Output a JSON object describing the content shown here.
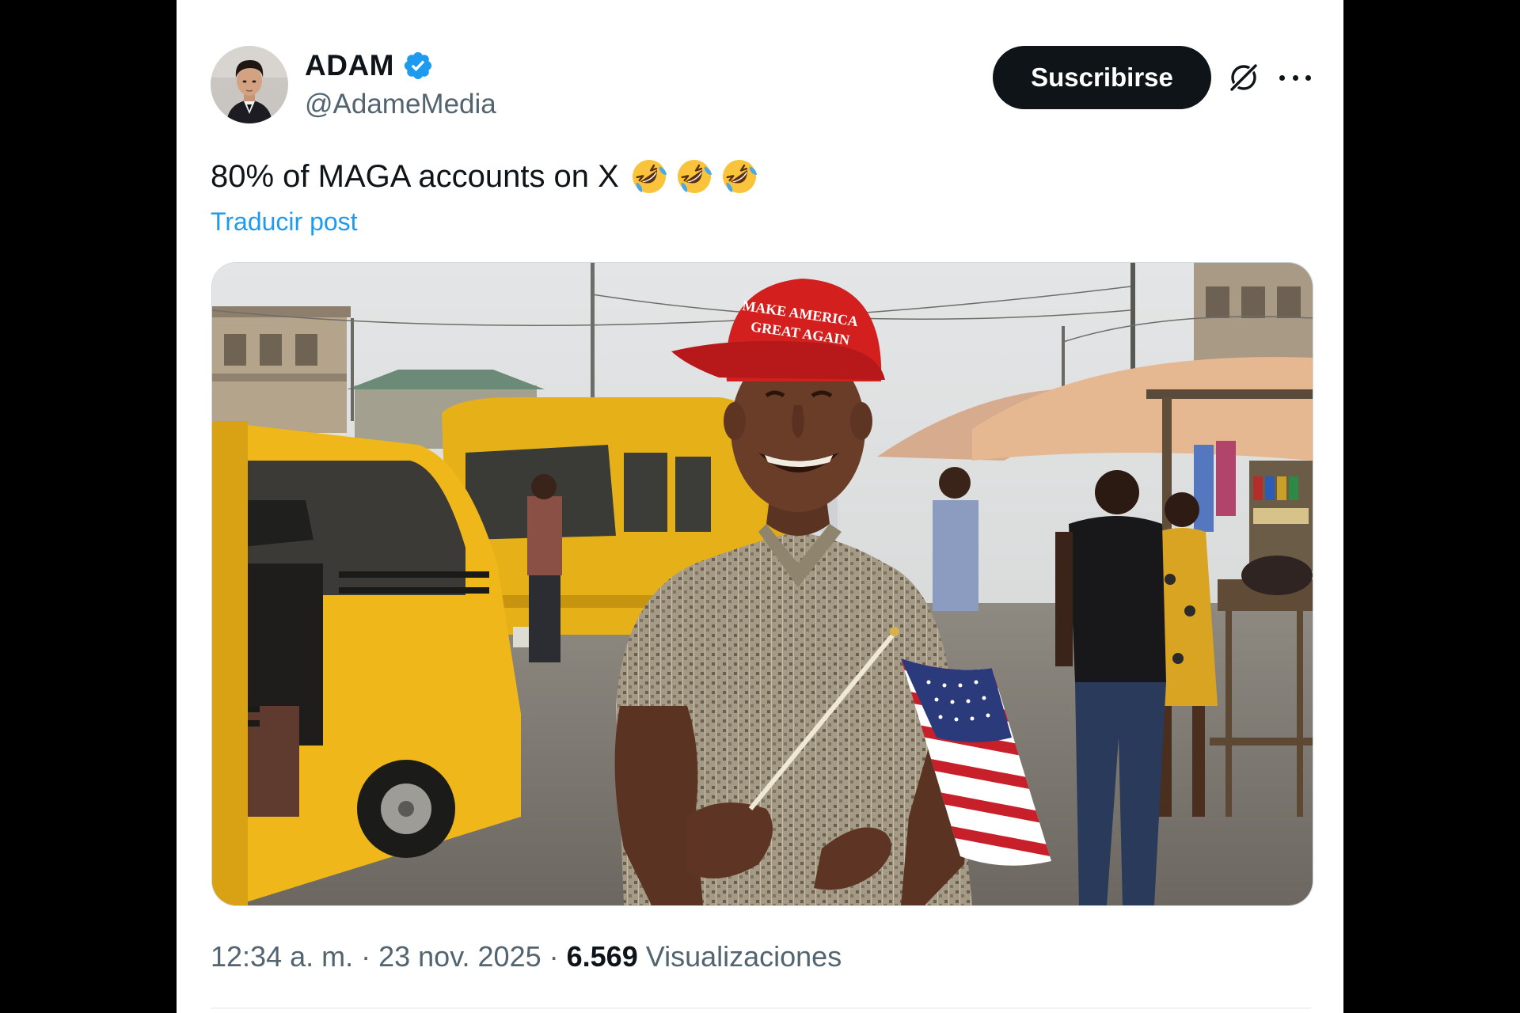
{
  "author": {
    "name": "ADAM",
    "handle": "@AdameMedia",
    "verified": true,
    "avatar_icon": "profile-photo"
  },
  "header": {
    "subscribe_label": "Suscribirse",
    "grok_icon": "grok-icon",
    "more_icon": "more-dots-icon"
  },
  "post": {
    "text": "80% of MAGA accounts on X",
    "emojis": [
      "rolling-on-floor-laughing",
      "rolling-on-floor-laughing",
      "rolling-on-floor-laughing"
    ],
    "translate_label": "Traducir post"
  },
  "media": {
    "hat_text_line1": "MAKE AMERICA",
    "hat_text_line2": "GREAT AGAIN"
  },
  "meta": {
    "time": "12:34 a. m.",
    "separator": "·",
    "date": "23 nov. 2025",
    "views_count": "6.569",
    "views_label": "Visualizaciones"
  },
  "colors": {
    "background": "#000000",
    "card": "#ffffff",
    "text_primary": "#0f1419",
    "text_secondary": "#536471",
    "link": "#1d9bf0",
    "verified": "#1d9bf0",
    "button": "#0f1419"
  }
}
